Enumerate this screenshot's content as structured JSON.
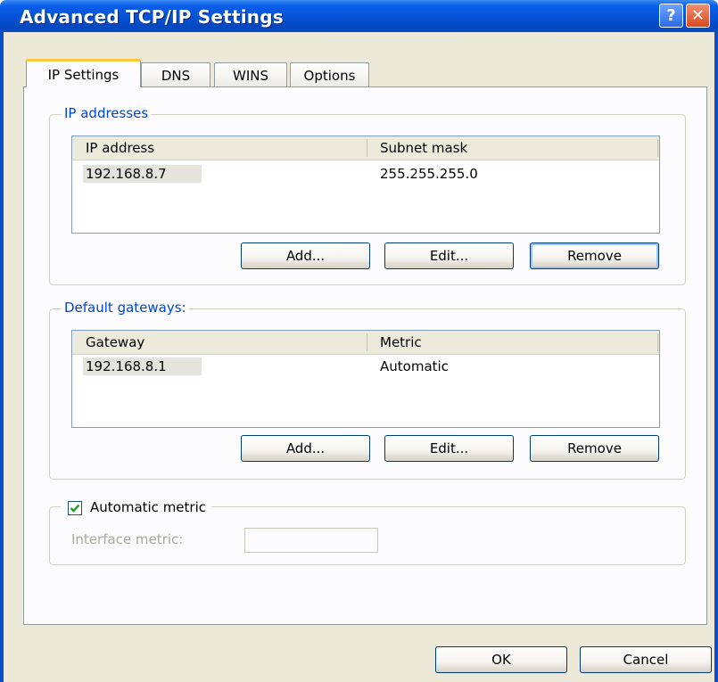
{
  "window": {
    "title": "Advanced TCP/IP Settings",
    "help_icon": "?",
    "close_icon": "✕"
  },
  "tabs": [
    {
      "label": "IP Settings",
      "active": true
    },
    {
      "label": "DNS",
      "active": false
    },
    {
      "label": "WINS",
      "active": false
    },
    {
      "label": "Options",
      "active": false
    }
  ],
  "ip_addresses": {
    "group_label": "IP addresses",
    "columns": [
      "IP address",
      "Subnet mask"
    ],
    "rows": [
      {
        "ip": "192.168.8.7",
        "mask": "255.255.255.0"
      }
    ],
    "buttons": {
      "add": "Add...",
      "edit": "Edit...",
      "remove": "Remove"
    }
  },
  "gateways": {
    "group_label": "Default gateways:",
    "columns": [
      "Gateway",
      "Metric"
    ],
    "rows": [
      {
        "gateway": "192.168.8.1",
        "metric": "Automatic"
      }
    ],
    "buttons": {
      "add": "Add...",
      "edit": "Edit...",
      "remove": "Remove"
    }
  },
  "metric": {
    "automatic_label": "Automatic metric",
    "automatic_checked": true,
    "interface_label": "Interface metric:",
    "interface_value": ""
  },
  "footer": {
    "ok": "OK",
    "cancel": "Cancel"
  },
  "colors": {
    "titlebar": "#0552d6",
    "dialog_bg": "#ece9d8",
    "group_label": "#0046d5",
    "active_tab_accent": "#ffc83c",
    "checkmark": "#21a121"
  }
}
